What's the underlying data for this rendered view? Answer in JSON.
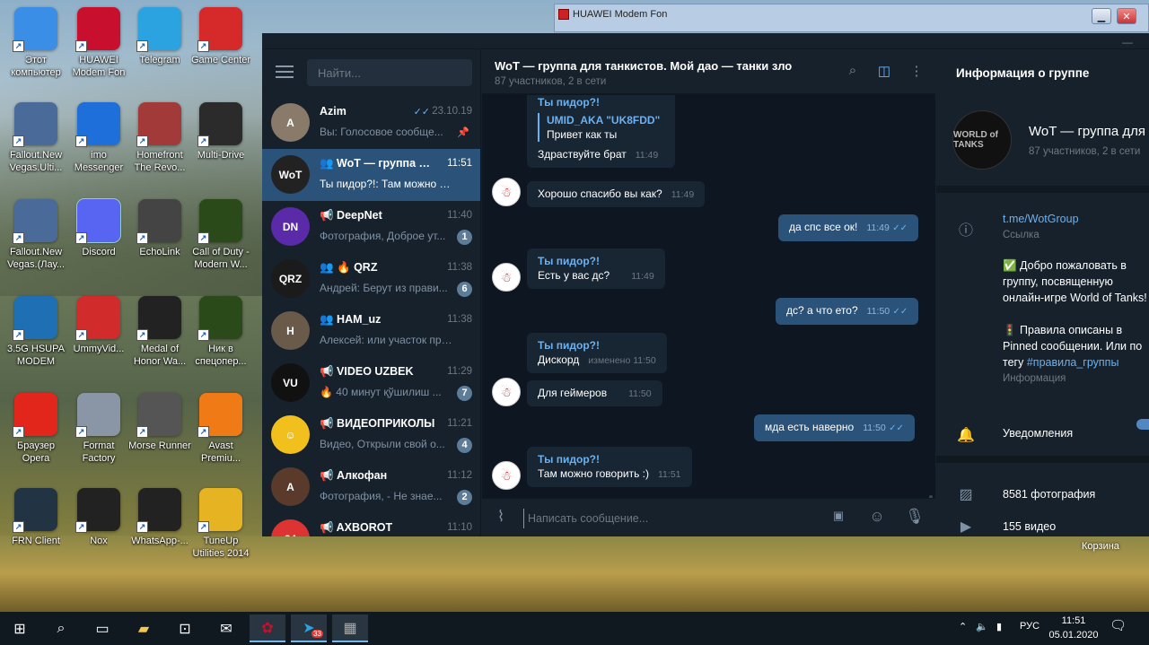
{
  "desktop": {
    "icons": [
      {
        "label": "Этот компьютер",
        "icon": "computer-icon",
        "color": "#3a8ee6"
      },
      {
        "label": "HUAWEI Modem Fon",
        "icon": "huawei-icon",
        "color": "#c8102e"
      },
      {
        "label": "Telegram",
        "icon": "telegram-icon",
        "color": "#2aa3e0"
      },
      {
        "label": "Game Center",
        "icon": "game-center-icon",
        "color": "#d62a2a"
      },
      {
        "label": "Fallout.New Vegas.Ulti...",
        "icon": "fallout-icon",
        "color": "#4a6a9a"
      },
      {
        "label": "imo Messenger",
        "icon": "imo-icon",
        "color": "#1e6fd9"
      },
      {
        "label": "Homefront The Revo...",
        "icon": "homefront-icon",
        "color": "#a23a3a"
      },
      {
        "label": "Multi-Drive",
        "icon": "nox-icon",
        "color": "#2b2b2b"
      },
      {
        "label": "Fallout.New Vegas.(Лау...",
        "icon": "fallout-icon",
        "color": "#4a6a9a"
      },
      {
        "label": "Discord",
        "icon": "discord-icon",
        "color": "#5865f2"
      },
      {
        "label": "EchoLink",
        "icon": "echolink-icon",
        "color": "#444"
      },
      {
        "label": "Call of Duty - Modern W...",
        "icon": "cod-icon",
        "color": "#2a4a1a"
      },
      {
        "label": "3.5G HSUPA MODEM",
        "icon": "globe-icon",
        "color": "#1e6fb4"
      },
      {
        "label": "UmmyVid...",
        "icon": "download-icon",
        "color": "#d22b2b"
      },
      {
        "label": "Medal of Honor Wa...",
        "icon": "medal-icon",
        "color": "#222"
      },
      {
        "label": "Ник в спецопер...",
        "icon": "cod-icon",
        "color": "#2a4a1a"
      },
      {
        "label": "Браузер Opera",
        "icon": "opera-icon",
        "color": "#e2261c"
      },
      {
        "label": "Format Factory",
        "icon": "format-factory-icon",
        "color": "#8a96a6"
      },
      {
        "label": "Morse Runner",
        "icon": "morse-icon",
        "color": "#555"
      },
      {
        "label": "Avast Premiu...",
        "icon": "avast-icon",
        "color": "#f07a15"
      },
      {
        "label": "FRN Client",
        "icon": "radio-icon",
        "color": "#234"
      },
      {
        "label": "Nox",
        "icon": "nox-icon",
        "color": "#222"
      },
      {
        "label": "WhatsApp-...",
        "icon": "nox-icon",
        "color": "#222"
      },
      {
        "label": "TuneUp Utilities 2014",
        "icon": "tuneup-icon",
        "color": "#e6b422"
      }
    ],
    "recycle_label": "Корзина"
  },
  "modem": {
    "title": "HUAWEI Modem Fon"
  },
  "telegram": {
    "search_placeholder": "Найти...",
    "chats": [
      {
        "name": "Azim",
        "time": "23.10.19",
        "preview": "Вы: Голосовое сообще...",
        "prefix": "Вы:",
        "pinned": true,
        "read": true,
        "color": "#8a7a6a",
        "initial": "A"
      },
      {
        "name": "WoT — группа дл...",
        "time": "11:51",
        "preview": "Ты пидор?!: Там можно гов...",
        "active": true,
        "group": true,
        "color": "#222",
        "initial": "WoT"
      },
      {
        "name": "DeepNet",
        "time": "11:40",
        "preview": "Фотография, Доброе ут...",
        "badge": "1",
        "channel": true,
        "color": "#5a2aa8",
        "initial": "DN"
      },
      {
        "name": "🔥 QRZ",
        "time": "11:38",
        "preview": "Андрей: Берут из прави...",
        "badge": "6",
        "group": true,
        "color": "#1b1b1b",
        "initial": "QRZ"
      },
      {
        "name": "HAM_uz",
        "time": "11:38",
        "preview": "Алексей: или участок пропу...",
        "group": true,
        "color": "#6a5a4a",
        "initial": "H"
      },
      {
        "name": "VIDEO UZBEK",
        "time": "11:29",
        "preview": "🔥 40 минут қўшилиш ...",
        "badge": "7",
        "channel": true,
        "color": "#111",
        "initial": "VU"
      },
      {
        "name": "ВИДЕОПРИКОЛЫ",
        "time": "11:21",
        "preview": "Видео, Открыли свой о...",
        "badge": "4",
        "channel": true,
        "color": "#f2c01d",
        "initial": "☺"
      },
      {
        "name": "Алкофан",
        "time": "11:12",
        "preview": "Фотография, - Не знае...",
        "badge": "2",
        "channel": true,
        "color": "#5a3a2a",
        "initial": "А"
      },
      {
        "name": "AXBOROT",
        "time": "11:10",
        "preview": "",
        "channel": true,
        "color": "#d33",
        "initial": "24"
      }
    ],
    "chat_title": "WoT — группа для танкистов. Мой дао — танки зло",
    "chat_subtitle": "87 участников, 2 в сети",
    "messages": {
      "m1_author": "Ты пидор?!",
      "m1_reply_author": "UMID_AKA \"UK8FDD\"",
      "m1_reply_text": "Привет как ты",
      "m1_text": "Здраствуйте брат",
      "m1_time": "11:49",
      "m2_text": "Хорошо спасибо вы как?",
      "m2_time": "11:49",
      "m3_text": "да спс все ок!",
      "m3_time": "11:49",
      "m4_author": "Ты пидор?!",
      "m4_text": "Есть у вас дс?",
      "m4_time": "11:49",
      "m5_text": "дс? а что ето?",
      "m5_time": "11:50",
      "m6_author": "Ты пидор?!",
      "m6_text": "Дискорд",
      "m6_time": "изменено 11:50",
      "m7_text": "Для геймеров",
      "m7_time": "11:50",
      "m8_text": "мда есть наверно",
      "m8_time": "11:50",
      "m9_author": "Ты пидор?!",
      "m9_text": "Там можно говорить :)",
      "m9_time": "11:51"
    },
    "compose_placeholder": "Написать сообщение...",
    "info": {
      "header": "Информация о группе",
      "group_name": "WoT — группа для",
      "group_sub": "87 участников, 2 в сети",
      "avatar_text": "WORLD of TANKS",
      "link": "t.me/WotGroup",
      "link_label": "Ссылка",
      "desc1": "✅ Добро пожаловать в группу, посвященную онлайн-игре World of Tanks!",
      "desc2": "🚦 Правила описаны в Pinned сообщении. Или по тегу",
      "desc_tag": "#правила_группы",
      "desc_label": "Информация",
      "notifications": "Уведомления",
      "photos": "8581 фотография",
      "videos": "155 видео"
    }
  },
  "taskbar": {
    "time": "11:51",
    "date": "05.01.2020",
    "lang": "РУС",
    "telegram_badge": "33"
  }
}
